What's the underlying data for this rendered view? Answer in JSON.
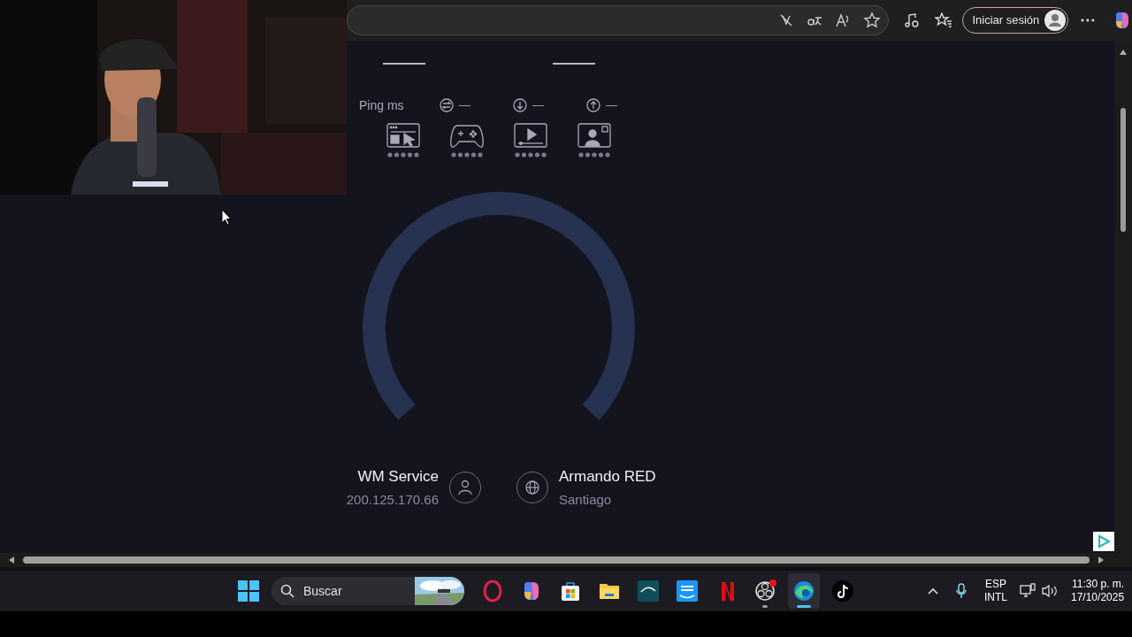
{
  "browser": {
    "signin_button": "Iniciar sesión"
  },
  "speedtest": {
    "ping_label": "Ping ms",
    "metrics": [
      {
        "kind": "jitter",
        "value": "—"
      },
      {
        "kind": "download",
        "value": "—"
      },
      {
        "kind": "upload",
        "value": "—"
      }
    ],
    "quality": [
      {
        "kind": "browsing"
      },
      {
        "kind": "gaming"
      },
      {
        "kind": "streaming"
      },
      {
        "kind": "video_call"
      }
    ],
    "provider": {
      "name": "WM Service",
      "ip": "200.125.170.66"
    },
    "server": {
      "name": "Armando RED",
      "location": "Santiago"
    }
  },
  "taskbar": {
    "search_placeholder": "Buscar",
    "apps": [
      {
        "kind": "opera",
        "running": false,
        "selected": false
      },
      {
        "kind": "copilot",
        "running": false,
        "selected": false
      },
      {
        "kind": "store",
        "running": false,
        "selected": false
      },
      {
        "kind": "files",
        "running": false,
        "selected": false
      },
      {
        "kind": "disney",
        "running": false,
        "selected": false
      },
      {
        "kind": "prime",
        "running": false,
        "selected": false
      },
      {
        "kind": "netflix",
        "running": false,
        "selected": false
      },
      {
        "kind": "obs",
        "running": true,
        "selected": false
      },
      {
        "kind": "edge",
        "running": true,
        "selected": true
      },
      {
        "kind": "tiktok",
        "running": false,
        "selected": false
      }
    ],
    "tray": {
      "language": "ESP",
      "layout": "INTL",
      "time": "11:30 p. m.",
      "date": "17/10/2025"
    }
  }
}
